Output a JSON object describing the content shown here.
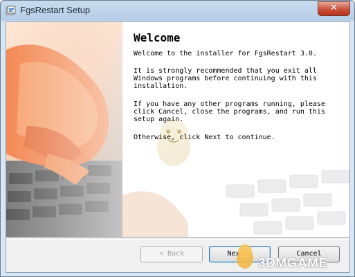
{
  "window": {
    "title": "FgsRestart Setup"
  },
  "titlebar": {
    "close_glyph": "✕"
  },
  "welcome": {
    "heading": "Welcome",
    "intro": "Welcome to the installer for FgsRestart 3.0.",
    "recommend": "It is strongly recommended that you exit all\nWindows programs before continuing with this\ninstallation.",
    "other_programs": "If you have any other programs running, please\nclick Cancel, close the programs, and run this\nsetup again.",
    "otherwise": "Otherwise, click Next to continue."
  },
  "buttons": {
    "back": "< Back",
    "next": "Next >",
    "cancel": "Cancel"
  },
  "watermark": "3DMGAME",
  "colors": {
    "accent": "#3c7fb1",
    "close": "#c7513a",
    "banner_skin": "#f08a5a"
  },
  "icons": {
    "app": "setup-app-icon",
    "close": "close-icon"
  }
}
